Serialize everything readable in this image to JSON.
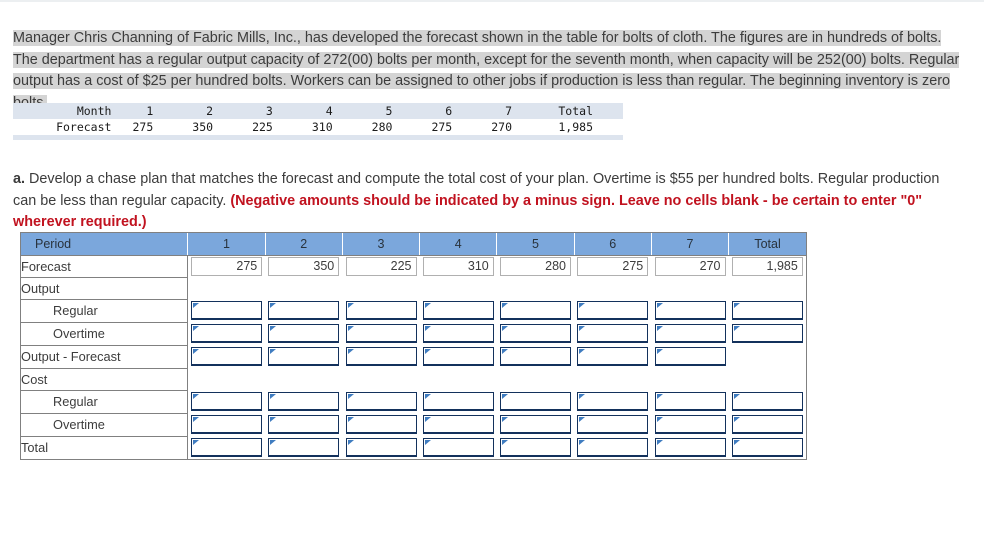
{
  "problem": {
    "text": "Manager Chris Channing of Fabric Mills, Inc., has developed the forecast shown in the table for bolts of cloth. The figures are in hundreds of bolts. The department has a regular output capacity of 272(00) bolts per month, except for the seventh month, when capacity will be 252(00) bolts. Regular output has a cost of $25 per hundred bolts. Workers can be assigned to other jobs if production is less than regular. The beginning inventory is zero bolts."
  },
  "forecast_table": {
    "row_labels": [
      "Month",
      "Forecast"
    ],
    "months": [
      "1",
      "2",
      "3",
      "4",
      "5",
      "6",
      "7"
    ],
    "total_label": "Total",
    "forecast_values": [
      "275",
      "350",
      "225",
      "310",
      "280",
      "275",
      "270"
    ],
    "forecast_total": "1,985"
  },
  "question": {
    "marker": "a.",
    "part1": " Develop a chase plan that matches the forecast and compute the total cost of your plan. Overtime is $55 per hundred bolts. Regular production can be less than regular capacity. ",
    "part2": "(Negative amounts should be indicated by a minus sign. Leave no cells blank - be certain to enter \"0\" wherever required.)",
    "red_color": "#c1121f"
  },
  "answer_table": {
    "header": {
      "period_label": "Period",
      "columns": [
        "1",
        "2",
        "3",
        "4",
        "5",
        "6",
        "7"
      ],
      "total_label": "Total",
      "header_bg": "#7ba7dc"
    },
    "rows": [
      {
        "label": "Forecast",
        "type": "readonly",
        "indent": false,
        "values": [
          "275",
          "350",
          "225",
          "310",
          "280",
          "275",
          "270"
        ],
        "total": "1,985"
      },
      {
        "label": "Output",
        "type": "section",
        "indent": false
      },
      {
        "label": "Regular",
        "type": "input",
        "indent": true,
        "values": [
          "",
          "",
          "",
          "",
          "",
          "",
          ""
        ],
        "total": ""
      },
      {
        "label": "Overtime",
        "type": "input",
        "indent": true,
        "values": [
          "",
          "",
          "",
          "",
          "",
          "",
          ""
        ],
        "total": ""
      },
      {
        "label": "Output - Forecast",
        "type": "input-nototal",
        "indent": false,
        "values": [
          "",
          "",
          "",
          "",
          "",
          "",
          ""
        ],
        "total": null
      },
      {
        "label": "Cost",
        "type": "section",
        "indent": false
      },
      {
        "label": "Regular",
        "type": "input",
        "indent": true,
        "values": [
          "",
          "",
          "",
          "",
          "",
          "",
          ""
        ],
        "total": ""
      },
      {
        "label": "Overtime",
        "type": "input",
        "indent": true,
        "values": [
          "",
          "",
          "",
          "",
          "",
          "",
          ""
        ],
        "total": ""
      },
      {
        "label": "Total",
        "type": "input",
        "indent": false,
        "values": [
          "",
          "",
          "",
          "",
          "",
          "",
          ""
        ],
        "total": ""
      }
    ]
  }
}
